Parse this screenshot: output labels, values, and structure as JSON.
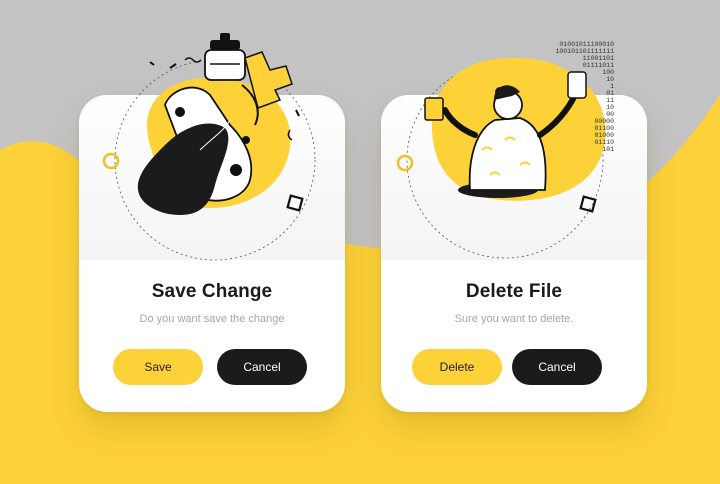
{
  "colors": {
    "background_gray": "#c4c3c4",
    "accent_yellow": "#fdd138",
    "dark": "#1b1b1b",
    "card": "#ffffff",
    "subtext": "#a6a6a6"
  },
  "dialogs": [
    {
      "title": "Save Change",
      "message": "Do you want save the change",
      "primary_label": "Save",
      "secondary_label": "Cancel",
      "illustration": "woman-with-puzzle-illustration"
    },
    {
      "title": "Delete File",
      "message": "Sure you want to delete.",
      "primary_label": "Delete",
      "secondary_label": "Cancel",
      "illustration": "person-with-binary-code-illustration"
    }
  ],
  "binary_rows": [
    "01001011100010",
    "100101101111111",
    "11001101",
    "01111011",
    "100",
    "10",
    "1",
    "01",
    "11",
    "10",
    "00",
    "00000",
    "01100",
    "01000",
    "01110",
    "101"
  ]
}
